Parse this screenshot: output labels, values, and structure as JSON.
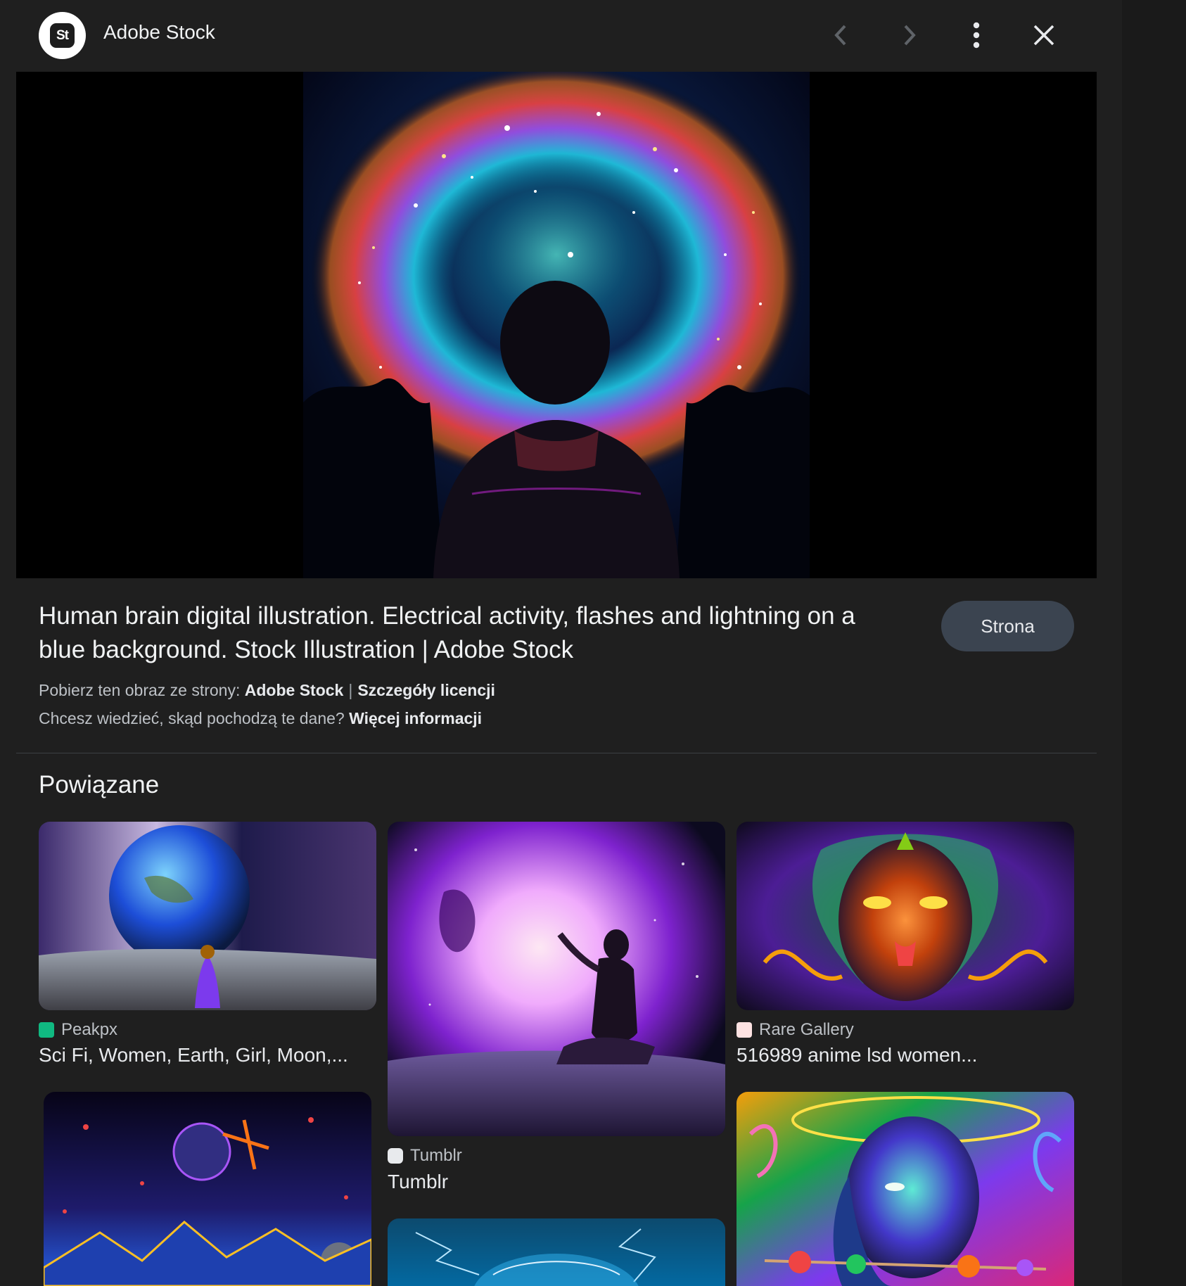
{
  "header": {
    "site_logo_text": "St",
    "site_name": "Adobe Stock",
    "icons": [
      "chevron-left-icon",
      "chevron-right-icon",
      "more-vert-icon",
      "close-icon"
    ]
  },
  "main": {
    "title": "Human brain digital illustration. Electrical activity, flashes and lightning on a blue background. Stock Illustration | Adobe Stock",
    "site_button_label": "Strona",
    "download_prefix": "Pobierz ten obraz ze strony:",
    "download_source": "Adobe Stock",
    "separator": "|",
    "license_link": "Szczegóły licencji",
    "data_question": "Chcesz wiedzieć, skąd pochodzą te dane?",
    "more_info_link": "Więcej informacji"
  },
  "related": {
    "heading": "Powiązane",
    "items": [
      {
        "source": "Peakpx",
        "title": "Sci Fi, Women, Earth, Girl, Moon,..."
      },
      {
        "source": "Tumblr",
        "title": "Tumblr"
      },
      {
        "source": "Rare Gallery",
        "title": "516989 anime lsd women..."
      }
    ]
  },
  "colors": {
    "background": "#1f1f1f",
    "button_bg": "#3b4450",
    "text_primary": "#e8eaed",
    "text_secondary": "#bdc1c6"
  }
}
